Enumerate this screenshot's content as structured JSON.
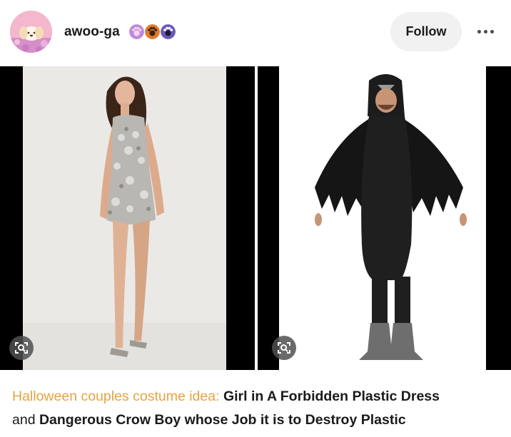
{
  "post": {
    "username": "awoo-ga",
    "badges": [
      {
        "icon": "paw-badge-icon",
        "color": "#b77ad6"
      },
      {
        "icon": "paw-badge-icon",
        "color": "#e07b2a"
      },
      {
        "icon": "pawprint-badge-icon",
        "color": "#6b59b8"
      }
    ],
    "follow_label": "Follow",
    "more_icon": "more-options-icon",
    "images": [
      {
        "subject": "sequin-dress-photo",
        "lens_icon": "visual-search-icon"
      },
      {
        "subject": "crow-costume-photo",
        "lens_icon": "visual-search-icon"
      }
    ],
    "caption": {
      "prefix": "Halloween couples costume idea:",
      "part1_bold": "Girl in A Forbidden Plastic Dress",
      "joiner": "and",
      "part2_bold": "Dangerous Crow Boy whose Job it is to Destroy Plastic"
    }
  },
  "colors": {
    "accent": "#e8a33d",
    "text": "#1a1a1a",
    "follow_bg": "#f1f1f1"
  }
}
